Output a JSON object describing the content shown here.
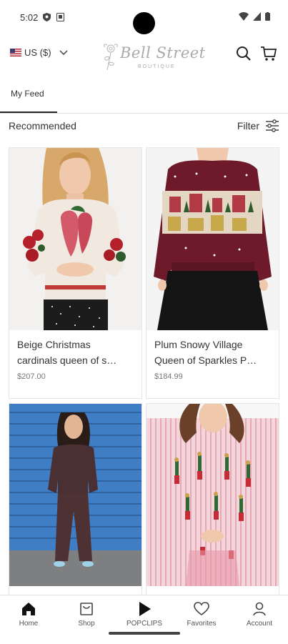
{
  "status": {
    "time": "5:02"
  },
  "header": {
    "currency": "US ($)",
    "logo_text": "Bell Street",
    "logo_sub": "BOUTIQUE"
  },
  "tabs": [
    {
      "label": "My Feed",
      "active": true
    }
  ],
  "section": {
    "title": "Recommended",
    "filter_label": "Filter"
  },
  "products": [
    {
      "title_line1": "Beige Christmas",
      "title_line2": "cardinals queen of s…",
      "price": "$207.00"
    },
    {
      "title_line1": "Plum Snowy Village",
      "title_line2": "Queen of Sparkles P…",
      "price": "$184.99"
    }
  ],
  "nav": [
    {
      "label": "Home",
      "icon": "home-icon"
    },
    {
      "label": "Shop",
      "icon": "shop-icon"
    },
    {
      "label": "POPCLIPS",
      "icon": "play-icon"
    },
    {
      "label": "Favorites",
      "icon": "heart-icon"
    },
    {
      "label": "Account",
      "icon": "person-icon"
    }
  ],
  "colors": {
    "accent": "#222222",
    "sweater_plum": "#6e1a2a",
    "sweater_beige": "#f1e9e0",
    "stripe_pink": "#e8a7b5",
    "wall_blue": "#3f7ec4"
  }
}
